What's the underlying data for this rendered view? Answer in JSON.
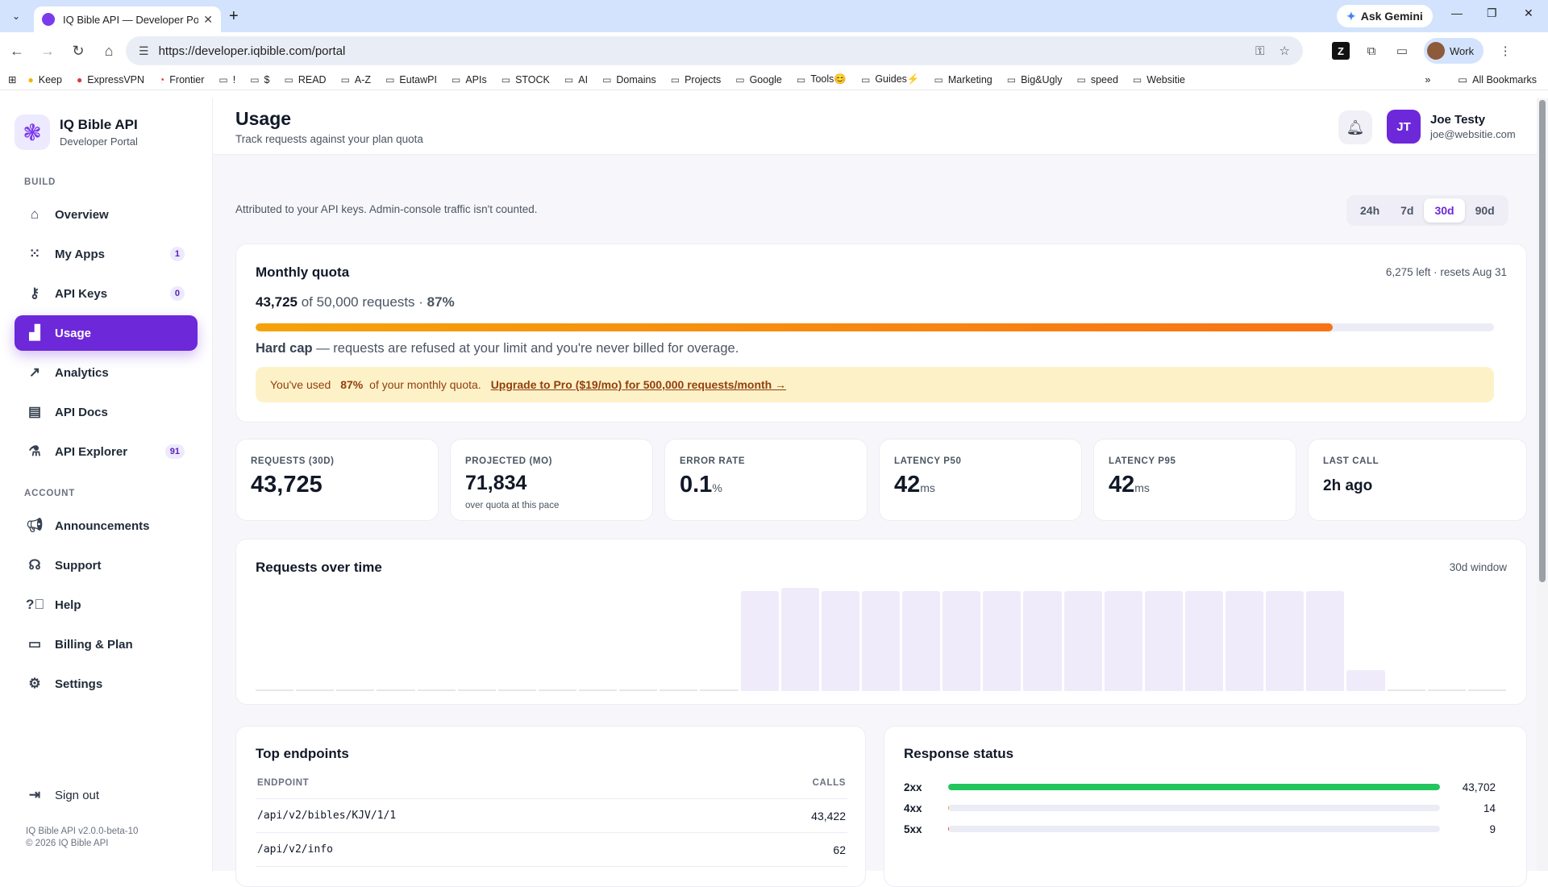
{
  "browser": {
    "tab_title": "IQ Bible API — Developer Porta",
    "ask_gemini": "Ask Gemini",
    "url": "https://developer.iqbible.com/portal",
    "profile": "Work",
    "bookmarks": [
      "Keep",
      "ExpressVPN",
      "Frontier",
      "!",
      "$",
      "READ",
      "A-Z",
      "EutawPI",
      "APIs",
      "STOCK",
      "AI",
      "Domains",
      "Projects",
      "Google",
      "Tools😊",
      "Guides⚡",
      "Marketing",
      "Big&Ugly",
      "speed",
      "Websitie"
    ],
    "all_bookmarks": "All Bookmarks"
  },
  "brand": {
    "name": "IQ Bible API",
    "subtitle": "Developer Portal"
  },
  "nav": {
    "build_label": "BUILD",
    "account_label": "ACCOUNT",
    "items": [
      {
        "label": "Overview",
        "icon": "home-icon"
      },
      {
        "label": "My Apps",
        "icon": "grid-icon",
        "badge": "1"
      },
      {
        "label": "API Keys",
        "icon": "key-icon",
        "badge": "0"
      },
      {
        "label": "Usage",
        "icon": "chart-icon",
        "active": true
      },
      {
        "label": "Analytics",
        "icon": "analytics-icon"
      },
      {
        "label": "API Docs",
        "icon": "book-icon"
      },
      {
        "label": "API Explorer",
        "icon": "flask-icon",
        "badge": "91"
      }
    ],
    "account_items": [
      {
        "label": "Announcements",
        "icon": "megaphone-icon"
      },
      {
        "label": "Support",
        "icon": "headset-icon"
      },
      {
        "label": "Help",
        "icon": "help-icon"
      },
      {
        "label": "Billing & Plan",
        "icon": "card-icon"
      },
      {
        "label": "Settings",
        "icon": "gear-icon"
      }
    ],
    "sign_out": "Sign out",
    "version": "IQ Bible API v2.0.0-beta-10",
    "copyright": "© 2026 IQ Bible API"
  },
  "header": {
    "title": "Usage",
    "subtitle": "Track requests against your plan quota",
    "user_initials": "JT",
    "user_name": "Joe Testy",
    "user_email": "joe@websitie.com"
  },
  "attribution": "Attributed to your API keys. Admin-console traffic isn't counted.",
  "ranges": [
    "24h",
    "7d",
    "30d",
    "90d"
  ],
  "selected_range": "30d",
  "quota": {
    "title": "Monthly quota",
    "remaining": "6,275 left · resets Aug 31",
    "used": "43,725",
    "of_text": " of 50,000 requests · ",
    "percent_text": "87%",
    "fraction": 0.87,
    "cap_bold": "Hard cap",
    "cap_text": " — requests are refused at your limit and you're never billed for overage.",
    "alert_pre": "You've used ",
    "alert_pct": "87%",
    "alert_post": " of your monthly quota.",
    "alert_link": "Upgrade to Pro ($19/mo) for 500,000 requests/month →"
  },
  "stats": [
    {
      "label": "REQUESTS (30D)",
      "value": "43,725",
      "unit": "",
      "sub": ""
    },
    {
      "label": "PROJECTED (MO)",
      "value": "71,834",
      "unit": "",
      "sub": "over quota at this pace"
    },
    {
      "label": "ERROR RATE",
      "value": "0.1",
      "unit": "%",
      "sub": ""
    },
    {
      "label": "LATENCY P50",
      "value": "42",
      "unit": "ms",
      "sub": ""
    },
    {
      "label": "LATENCY P95",
      "value": "42",
      "unit": "ms",
      "sub": ""
    },
    {
      "label": "LAST CALL",
      "value": "2h ago",
      "unit": "",
      "sub": ""
    }
  ],
  "chart_data": {
    "type": "bar",
    "title": "Requests over time",
    "window_label": "30d window",
    "values": [
      0,
      0,
      0,
      0,
      0,
      0,
      0,
      0,
      0,
      0,
      0,
      0,
      97,
      100,
      97,
      97,
      97,
      97,
      97,
      97,
      97,
      97,
      97,
      97,
      97,
      97,
      97,
      20,
      0,
      0,
      0
    ],
    "ylim": [
      0,
      100
    ],
    "grid": false
  },
  "endpoints": {
    "title": "Top endpoints",
    "col_endpoint": "ENDPOINT",
    "col_calls": "CALLS",
    "rows": [
      {
        "endpoint": "/api/v2/bibles/KJV/1/1",
        "calls": "43,422"
      },
      {
        "endpoint": "/api/v2/info",
        "calls": "62"
      }
    ]
  },
  "response_status": {
    "title": "Response status",
    "rows": [
      {
        "code": "2xx",
        "count": "43,702",
        "fraction": 0.9995,
        "color": "#22c55e"
      },
      {
        "code": "4xx",
        "count": "14",
        "fraction": 0.0003,
        "color": "#f59e0b"
      },
      {
        "code": "5xx",
        "count": "9",
        "fraction": 0.0002,
        "color": "#ef4444"
      }
    ]
  }
}
